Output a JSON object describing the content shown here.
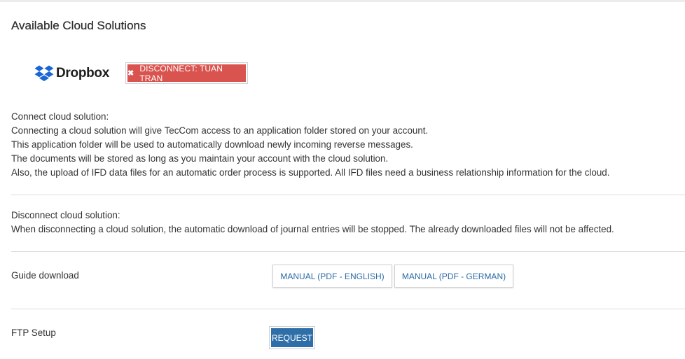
{
  "title": "Available Cloud Solutions",
  "provider": {
    "name": "Dropbox",
    "icon": "dropbox-icon",
    "disconnect_label": "DISCONNECT: TUAN TRAN",
    "disconnect_icon": "close-icon",
    "disconnect_color": "#d9534f"
  },
  "connect": {
    "heading": "Connect cloud solution:",
    "lines": [
      "Connecting a cloud solution will give TecCom access to an application folder stored on your account.",
      "This application folder will be used to automatically download newly incoming reverse messages.",
      "The documents will be stored as long as you maintain your account with the cloud solution.",
      "Also, the upload of IFD data files for an automatic order process is supported. All IFD files need a business relationship information for the cloud."
    ]
  },
  "disconnect": {
    "heading": "Disconnect cloud solution:",
    "text": "When disconnecting a cloud solution, the automatic download of journal entries will be stopped. The already downloaded files will not be affected."
  },
  "guide": {
    "label": "Guide download",
    "manual_english": "MANUAL (PDF - ENGLISH)",
    "manual_german": "MANUAL (PDF - GERMAN)"
  },
  "ftp": {
    "label": "FTP Setup",
    "request_label": "REQUEST",
    "request_color": "#2f6fa9"
  }
}
